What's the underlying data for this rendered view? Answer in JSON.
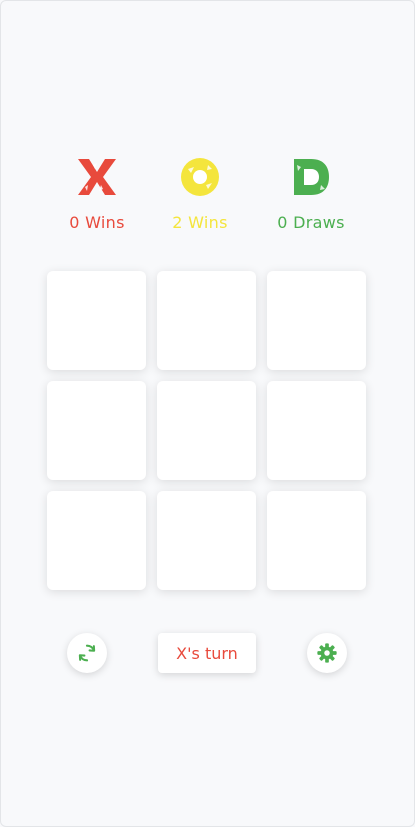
{
  "colors": {
    "x": "#e84a3c",
    "o": "#f4e53c",
    "draw": "#4caf50",
    "background": "#f8f9fb"
  },
  "scores": {
    "x": {
      "icon": "x-logo-icon",
      "label": "0 Wins"
    },
    "o": {
      "icon": "o-logo-icon",
      "label": "2 Wins"
    },
    "draws": {
      "icon": "d-logo-icon",
      "label": "0 Draws"
    }
  },
  "board": {
    "cells": [
      "",
      "",
      "",
      "",
      "",
      "",
      "",
      "",
      ""
    ]
  },
  "controls": {
    "restart_icon": "refresh-icon",
    "turn_label": "X's turn",
    "settings_icon": "gear-icon"
  }
}
